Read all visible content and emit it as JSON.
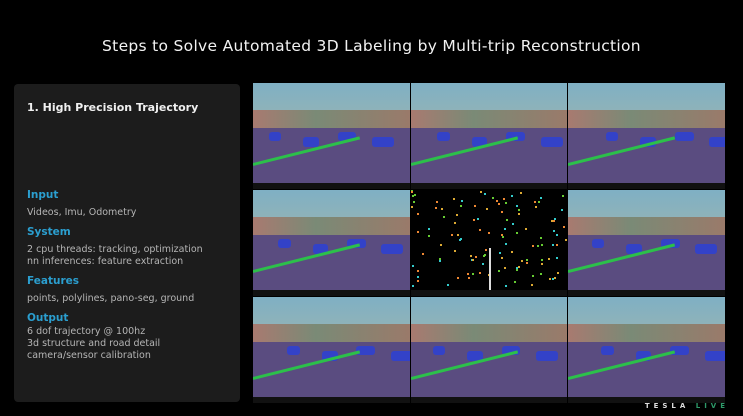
{
  "slide": {
    "title": "Steps to Solve Automated 3D Labeling by Multi-trip Reconstruction"
  },
  "panel": {
    "heading": "1. High Precision Trajectory",
    "sections": [
      {
        "label": "Input",
        "lines": [
          "Videos, Imu, Odometry"
        ]
      },
      {
        "label": "System",
        "lines": [
          "2 cpu threads: tracking, optimization",
          "nn inferences: feature extraction"
        ]
      },
      {
        "label": "Features",
        "lines": [
          "points, polylines, pano-seg, ground"
        ]
      },
      {
        "label": "Output",
        "lines": [
          "6 dof trajectory @ 100hz",
          "3d structure and road detail",
          "camera/sensor calibration"
        ]
      }
    ]
  },
  "footer": {
    "brand": "TESLA",
    "event": "LIVE"
  },
  "colors": {
    "accent": "#2b9fd0",
    "live": "#2e9a6a"
  }
}
